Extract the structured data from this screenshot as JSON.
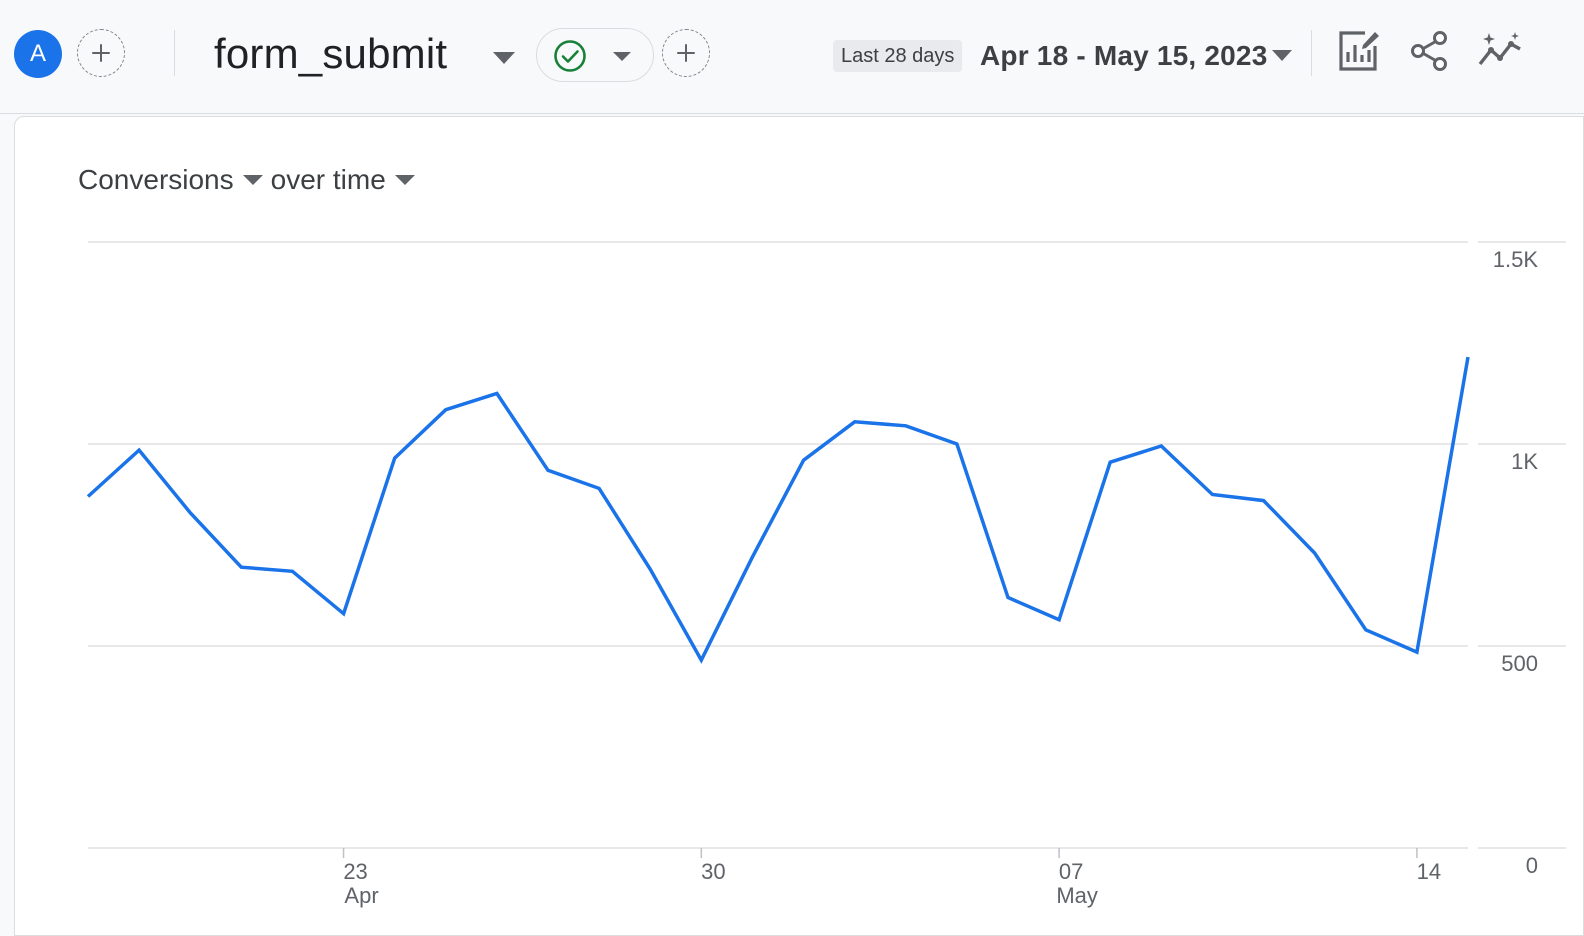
{
  "header": {
    "avatar_letter": "A",
    "event_name": "form_submit",
    "period_label": "Last 28 days",
    "date_range": "Apr 18 - May 15, 2023"
  },
  "chart_header": {
    "metric_label": "Conversions",
    "dimension_label": "over time"
  },
  "colors": {
    "line": "#1a73e8",
    "gridline": "#e0e0e0",
    "accent_blue": "#1a73e8",
    "check_green": "#188038"
  },
  "icons": [
    "add-icon",
    "caret-down-icon",
    "check-circle-icon",
    "edit-report-icon",
    "share-icon",
    "insights-icon"
  ],
  "chart_data": {
    "type": "line",
    "title": "",
    "xlabel": "",
    "ylabel": "",
    "ylim": [
      0,
      1500
    ],
    "y_ticks": [
      {
        "value": 1500,
        "label": "1.5K"
      },
      {
        "value": 1000,
        "label": "1K"
      },
      {
        "value": 500,
        "label": "500"
      },
      {
        "value": 0,
        "label": "0"
      }
    ],
    "x_ticks": [
      {
        "x": "2023-04-23",
        "day": "23",
        "month": "Apr"
      },
      {
        "x": "2023-04-30",
        "day": "30",
        "month": ""
      },
      {
        "x": "2023-05-07",
        "day": "07",
        "month": "May"
      },
      {
        "x": "2023-05-14",
        "day": "14",
        "month": ""
      }
    ],
    "grid": true,
    "y_axis_side": "right",
    "series": [
      {
        "x": [
          "2023-04-18",
          "2023-04-19",
          "2023-04-20",
          "2023-04-21",
          "2023-04-22",
          "2023-04-23",
          "2023-04-24",
          "2023-04-25",
          "2023-04-26",
          "2023-04-27",
          "2023-04-28",
          "2023-04-29",
          "2023-04-30",
          "2023-05-01",
          "2023-05-02",
          "2023-05-03",
          "2023-05-04",
          "2023-05-05",
          "2023-05-06",
          "2023-05-07",
          "2023-05-08",
          "2023-05-09",
          "2023-05-10",
          "2023-05-11",
          "2023-05-12",
          "2023-05-13",
          "2023-05-14",
          "2023-05-15"
        ],
        "values": [
          870,
          985,
          830,
          695,
          685,
          580,
          965,
          1085,
          1125,
          935,
          890,
          690,
          465,
          720,
          960,
          1055,
          1045,
          1000,
          620,
          565,
          955,
          995,
          875,
          860,
          730,
          540,
          485,
          1215
        ]
      }
    ]
  }
}
